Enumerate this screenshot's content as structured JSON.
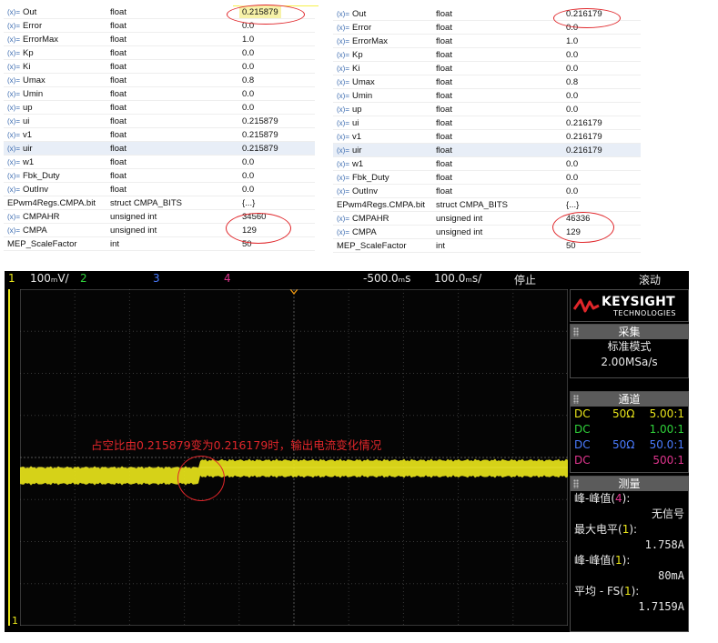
{
  "left_table": {
    "rows": [
      {
        "name": "Out",
        "type": "float",
        "value": "0.215879"
      },
      {
        "name": "Error",
        "type": "float",
        "value": "0.0"
      },
      {
        "name": "ErrorMax",
        "type": "float",
        "value": "1.0"
      },
      {
        "name": "Kp",
        "type": "float",
        "value": "0.0"
      },
      {
        "name": "Ki",
        "type": "float",
        "value": "0.0"
      },
      {
        "name": "Umax",
        "type": "float",
        "value": "0.8"
      },
      {
        "name": "Umin",
        "type": "float",
        "value": "0.0"
      },
      {
        "name": "up",
        "type": "float",
        "value": "0.0"
      },
      {
        "name": "ui",
        "type": "float",
        "value": "0.215879"
      },
      {
        "name": "v1",
        "type": "float",
        "value": "0.215879"
      },
      {
        "name": "uir",
        "type": "float",
        "value": "0.215879"
      },
      {
        "name": "w1",
        "type": "float",
        "value": "0.0"
      },
      {
        "name": "Fbk_Duty",
        "type": "float",
        "value": "0.0"
      },
      {
        "name": "OutInv",
        "type": "float",
        "value": "0.0"
      },
      {
        "name": "EPwm4Regs.CMPA.bit",
        "type": "struct CMPA_BITS",
        "value": "{...}"
      },
      {
        "name": "CMPAHR",
        "type": "unsigned int",
        "value": "34560"
      },
      {
        "name": "CMPA",
        "type": "unsigned int",
        "value": "129"
      },
      {
        "name": "MEP_ScaleFactor",
        "type": "int",
        "value": "50"
      }
    ]
  },
  "right_table": {
    "rows": [
      {
        "name": "Out",
        "type": "float",
        "value": "0.216179"
      },
      {
        "name": "Error",
        "type": "float",
        "value": "0.0"
      },
      {
        "name": "ErrorMax",
        "type": "float",
        "value": "1.0"
      },
      {
        "name": "Kp",
        "type": "float",
        "value": "0.0"
      },
      {
        "name": "Ki",
        "type": "float",
        "value": "0.0"
      },
      {
        "name": "Umax",
        "type": "float",
        "value": "0.8"
      },
      {
        "name": "Umin",
        "type": "float",
        "value": "0.0"
      },
      {
        "name": "up",
        "type": "float",
        "value": "0.0"
      },
      {
        "name": "ui",
        "type": "float",
        "value": "0.216179"
      },
      {
        "name": "v1",
        "type": "float",
        "value": "0.216179"
      },
      {
        "name": "uir",
        "type": "float",
        "value": "0.216179"
      },
      {
        "name": "w1",
        "type": "float",
        "value": "0.0"
      },
      {
        "name": "Fbk_Duty",
        "type": "float",
        "value": "0.0"
      },
      {
        "name": "OutInv",
        "type": "float",
        "value": "0.0"
      },
      {
        "name": "EPwm4Regs.CMPA.bit",
        "type": "struct CMPA_BITS",
        "value": "{...}"
      },
      {
        "name": "CMPAHR",
        "type": "unsigned int",
        "value": "46336"
      },
      {
        "name": "CMPA",
        "type": "unsigned int",
        "value": "129"
      },
      {
        "name": "MEP_ScaleFactor",
        "type": "int",
        "value": "50"
      }
    ]
  },
  "icon": "(x)=",
  "scope": {
    "topbar": {
      "ch1_num": "1",
      "ch1_scale": "100ₘV/",
      "ch2_num": "2",
      "ch3_num": "3",
      "ch4_num": "4",
      "time_delay": "-500.0ₘs",
      "time_scale": "100.0ₘs/",
      "run_state": "停止",
      "mode": "滚动"
    },
    "annotation": "占空比由0.215879变为0.216179时，输出电流变化情况",
    "ground_marker": "1",
    "brand": {
      "name": "KEYSIGHT",
      "sub": "TECHNOLOGIES"
    },
    "acquisition": {
      "title": "采集",
      "mode": "标准模式",
      "rate": "2.00MSa/s"
    },
    "channels": {
      "title": "通道",
      "rows": [
        {
          "coupling": "DC",
          "imp": "50Ω",
          "ratio": "5.00:1",
          "color": "#e8e41a"
        },
        {
          "coupling": "DC",
          "imp": "",
          "ratio": "1.00:1",
          "color": "#2fd13a"
        },
        {
          "coupling": "DC",
          "imp": "50Ω",
          "ratio": "50.0:1",
          "color": "#4a7bff"
        },
        {
          "coupling": "DC",
          "imp": "",
          "ratio": "500:1",
          "color": "#e0358e"
        }
      ]
    },
    "measure": {
      "title": "测量",
      "items": [
        {
          "label_pre": "峰-峰值(",
          "label_ch": "4",
          "label_post": "):",
          "value": "无信号",
          "ch_color": "#e0358e"
        },
        {
          "label_pre": "最大电平(",
          "label_ch": "1",
          "label_post": "):",
          "value": "1.758A",
          "ch_color": "#e8e41a"
        },
        {
          "label_pre": "峰-峰值(",
          "label_ch": "1",
          "label_post": "):",
          "value": "80mA",
          "ch_color": "#e8e41a"
        },
        {
          "label_pre": "平均 - FS(",
          "label_ch": "1",
          "label_post": "):",
          "value": "1.7159A",
          "ch_color": "#e8e41a"
        }
      ]
    },
    "colors": {
      "ch1": "#e8e41a",
      "ch2": "#2fd13a",
      "ch3": "#4a7bff",
      "ch4": "#e0358e",
      "highlight": "#e0262a"
    }
  }
}
